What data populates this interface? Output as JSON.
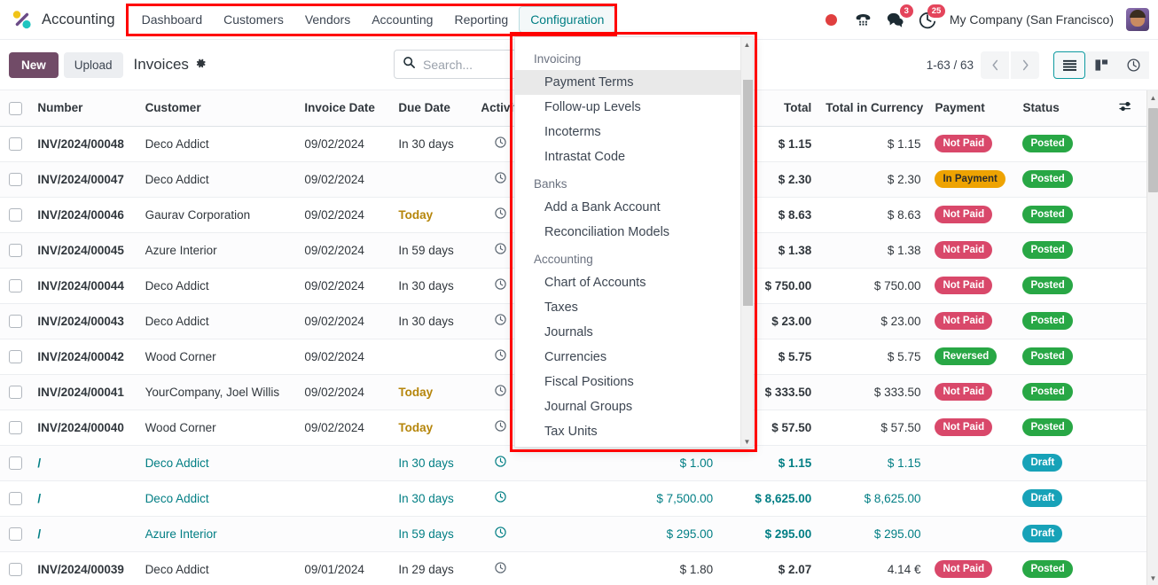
{
  "navbar": {
    "logo_icon": "odoo-accounting-logo-icon",
    "app_name": "Accounting",
    "menu_items": [
      {
        "label": "Dashboard",
        "active": false
      },
      {
        "label": "Customers",
        "active": false
      },
      {
        "label": "Vendors",
        "active": false
      },
      {
        "label": "Accounting",
        "active": false
      },
      {
        "label": "Reporting",
        "active": false
      },
      {
        "label": "Configuration",
        "active": true
      }
    ],
    "systray": {
      "record_dot": "record-indicator-icon",
      "phone_icon": "dialpad-phone-icon",
      "messages_icon": "chat-bubble-icon",
      "messages_count": "3",
      "activities_icon": "clock-activity-icon",
      "activities_count": "25",
      "company": "My Company (San Francisco)",
      "avatar": "user-avatar"
    }
  },
  "control_panel": {
    "new_label": "New",
    "upload_label": "Upload",
    "breadcrumb": "Invoices",
    "gear_icon": "gear-icon",
    "search_icon": "search-icon",
    "search_placeholder": "Search...",
    "search_value": "",
    "pager": "1-63 / 63",
    "prev_icon": "chevron-left-icon",
    "next_icon": "chevron-right-icon",
    "views": [
      {
        "name": "list",
        "icon": "list-view-icon",
        "active": true
      },
      {
        "name": "kanban",
        "icon": "kanban-view-icon",
        "active": false
      },
      {
        "name": "activity",
        "icon": "activity-view-icon",
        "active": false
      }
    ]
  },
  "dropdown": {
    "visible": true,
    "sections": [
      {
        "title": "Invoicing",
        "items": [
          {
            "label": "Payment Terms",
            "highlighted": true
          },
          {
            "label": "Follow-up Levels",
            "highlighted": false
          },
          {
            "label": "Incoterms",
            "highlighted": false
          },
          {
            "label": "Intrastat Code",
            "highlighted": false
          }
        ]
      },
      {
        "title": "Banks",
        "items": [
          {
            "label": "Add a Bank Account",
            "highlighted": false
          },
          {
            "label": "Reconciliation Models",
            "highlighted": false
          }
        ]
      },
      {
        "title": "Accounting",
        "items": [
          {
            "label": "Chart of Accounts",
            "highlighted": false
          },
          {
            "label": "Taxes",
            "highlighted": false
          },
          {
            "label": "Journals",
            "highlighted": false
          },
          {
            "label": "Currencies",
            "highlighted": false
          },
          {
            "label": "Fiscal Positions",
            "highlighted": false
          },
          {
            "label": "Journal Groups",
            "highlighted": false
          },
          {
            "label": "Tax Units",
            "highlighted": false
          }
        ]
      }
    ]
  },
  "table": {
    "columns": [
      {
        "key": "select",
        "label": ""
      },
      {
        "key": "number",
        "label": "Number"
      },
      {
        "key": "customer",
        "label": "Customer"
      },
      {
        "key": "invoice_date",
        "label": "Invoice Date"
      },
      {
        "key": "due_date",
        "label": "Due Date"
      },
      {
        "key": "activity",
        "label": "Activity"
      },
      {
        "key": "tax_excluded",
        "label": ""
      },
      {
        "key": "total",
        "label": "Total"
      },
      {
        "key": "total_in_currency",
        "label": "Total in Currency"
      },
      {
        "key": "payment",
        "label": "Payment"
      },
      {
        "key": "status",
        "label": "Status"
      },
      {
        "key": "options",
        "label": ""
      }
    ],
    "optional_columns_icon": "column-settings-icon",
    "activity_icon": "clock-icon",
    "rows": [
      {
        "number": "INV/2024/00048",
        "customer": "Deco Addict",
        "invoice_date": "09/02/2024",
        "due_date": "In 30 days",
        "due_today": false,
        "tax_excluded": "",
        "total": "$ 1.15",
        "total_in_currency": "$ 1.15",
        "payment": "Not Paid",
        "payment_kind": "notpaid",
        "status": "Posted",
        "status_kind": "posted",
        "draft": false
      },
      {
        "number": "INV/2024/00047",
        "customer": "Deco Addict",
        "invoice_date": "09/02/2024",
        "due_date": "",
        "due_today": false,
        "tax_excluded": "",
        "total": "$ 2.30",
        "total_in_currency": "$ 2.30",
        "payment": "In Payment",
        "payment_kind": "inpayment",
        "status": "Posted",
        "status_kind": "posted",
        "draft": false
      },
      {
        "number": "INV/2024/00046",
        "customer": "Gaurav Corporation",
        "invoice_date": "09/02/2024",
        "due_date": "Today",
        "due_today": true,
        "tax_excluded": "",
        "total": "$ 8.63",
        "total_in_currency": "$ 8.63",
        "payment": "Not Paid",
        "payment_kind": "notpaid",
        "status": "Posted",
        "status_kind": "posted",
        "draft": false
      },
      {
        "number": "INV/2024/00045",
        "customer": "Azure Interior",
        "invoice_date": "09/02/2024",
        "due_date": "In 59 days",
        "due_today": false,
        "tax_excluded": "",
        "total": "$ 1.38",
        "total_in_currency": "$ 1.38",
        "payment": "Not Paid",
        "payment_kind": "notpaid",
        "status": "Posted",
        "status_kind": "posted",
        "draft": false
      },
      {
        "number": "INV/2024/00044",
        "customer": "Deco Addict",
        "invoice_date": "09/02/2024",
        "due_date": "In 30 days",
        "due_today": false,
        "tax_excluded": "",
        "total": "$ 750.00",
        "total_in_currency": "$ 750.00",
        "payment": "Not Paid",
        "payment_kind": "notpaid",
        "status": "Posted",
        "status_kind": "posted",
        "draft": false
      },
      {
        "number": "INV/2024/00043",
        "customer": "Deco Addict",
        "invoice_date": "09/02/2024",
        "due_date": "In 30 days",
        "due_today": false,
        "tax_excluded": "",
        "total": "$ 23.00",
        "total_in_currency": "$ 23.00",
        "payment": "Not Paid",
        "payment_kind": "notpaid",
        "status": "Posted",
        "status_kind": "posted",
        "draft": false
      },
      {
        "number": "INV/2024/00042",
        "customer": "Wood Corner",
        "invoice_date": "09/02/2024",
        "due_date": "",
        "due_today": false,
        "tax_excluded": "",
        "total": "$ 5.75",
        "total_in_currency": "$ 5.75",
        "payment": "Reversed",
        "payment_kind": "reversed",
        "status": "Posted",
        "status_kind": "posted",
        "draft": false
      },
      {
        "number": "INV/2024/00041",
        "customer": "YourCompany, Joel Willis",
        "invoice_date": "09/02/2024",
        "due_date": "Today",
        "due_today": true,
        "tax_excluded": "",
        "total": "$ 333.50",
        "total_in_currency": "$ 333.50",
        "payment": "Not Paid",
        "payment_kind": "notpaid",
        "status": "Posted",
        "status_kind": "posted",
        "draft": false
      },
      {
        "number": "INV/2024/00040",
        "customer": "Wood Corner",
        "invoice_date": "09/02/2024",
        "due_date": "Today",
        "due_today": true,
        "tax_excluded": "",
        "total": "$ 57.50",
        "total_in_currency": "$ 57.50",
        "payment": "Not Paid",
        "payment_kind": "notpaid",
        "status": "Posted",
        "status_kind": "posted",
        "draft": false
      },
      {
        "number": "/",
        "customer": "Deco Addict",
        "invoice_date": "",
        "due_date": "In 30 days",
        "due_today": false,
        "tax_excluded": "$ 1.00",
        "total": "$ 1.15",
        "total_in_currency": "$ 1.15",
        "payment": "",
        "payment_kind": "",
        "status": "Draft",
        "status_kind": "draft",
        "draft": true
      },
      {
        "number": "/",
        "customer": "Deco Addict",
        "invoice_date": "",
        "due_date": "In 30 days",
        "due_today": false,
        "tax_excluded": "$ 7,500.00",
        "total": "$ 8,625.00",
        "total_in_currency": "$ 8,625.00",
        "payment": "",
        "payment_kind": "",
        "status": "Draft",
        "status_kind": "draft",
        "draft": true
      },
      {
        "number": "/",
        "customer": "Azure Interior",
        "invoice_date": "",
        "due_date": "In 59 days",
        "due_today": false,
        "tax_excluded": "$ 295.00",
        "total": "$ 295.00",
        "total_in_currency": "$ 295.00",
        "payment": "",
        "payment_kind": "",
        "status": "Draft",
        "status_kind": "draft",
        "draft": true
      },
      {
        "number": "INV/2024/00039",
        "customer": "Deco Addict",
        "invoice_date": "09/01/2024",
        "due_date": "In 29 days",
        "due_today": false,
        "tax_excluded": "$ 1.80",
        "total": "$ 2.07",
        "total_in_currency": "4.14 €",
        "payment": "Not Paid",
        "payment_kind": "notpaid",
        "status": "Posted",
        "status_kind": "posted",
        "draft": false
      }
    ]
  },
  "annotations": {
    "highlight_menu": "red-box-around-main-menu",
    "highlight_dropdown": "red-box-around-configuration-dropdown"
  },
  "colors": {
    "brand_purple": "#714b67",
    "accent_teal": "#017e84",
    "danger": "#d9486a",
    "success": "#28a745",
    "warning": "#eea302",
    "draft": "#17a2b8",
    "annotation_red": "#ff0000"
  }
}
